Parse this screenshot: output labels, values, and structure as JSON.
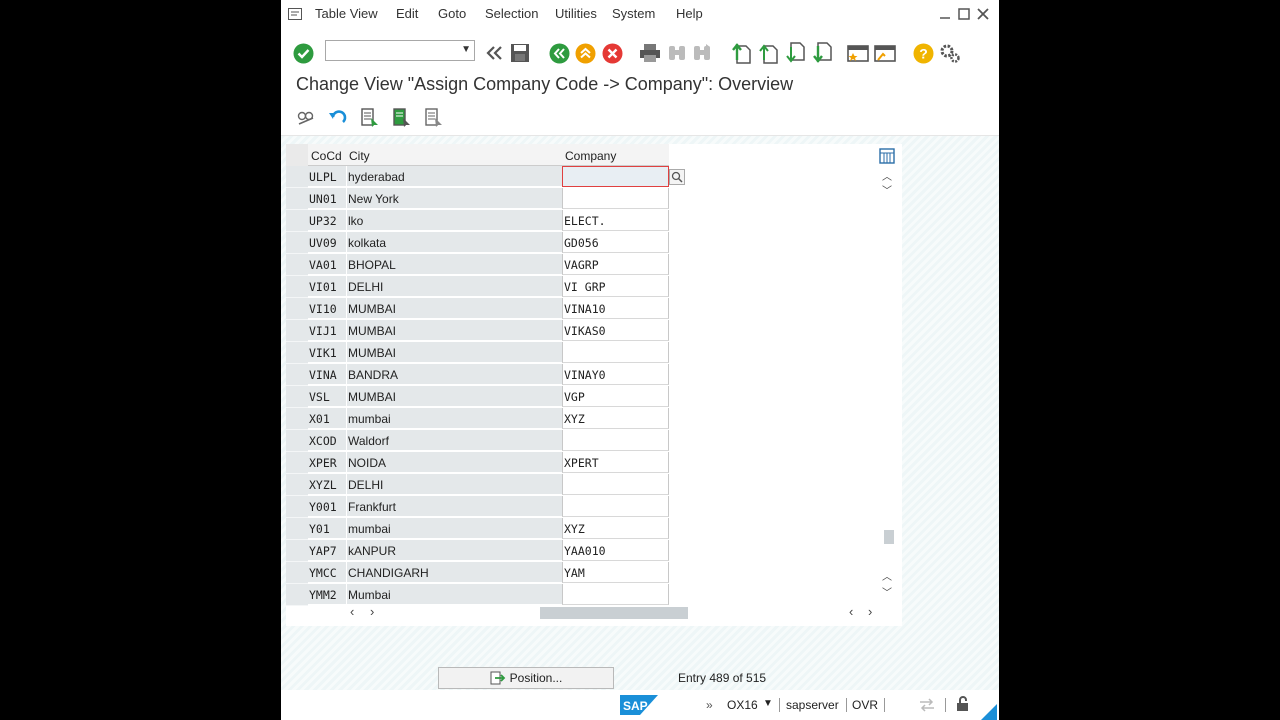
{
  "menu": [
    "Table View",
    "Edit",
    "Goto",
    "Selection",
    "Utilities",
    "System",
    "Help"
  ],
  "title": "Change View \"Assign Company Code -> Company\": Overview",
  "table": {
    "columns": [
      "CoCd",
      "City",
      "Company"
    ],
    "rows": [
      {
        "cocd": "ULPL",
        "city": "hyderabad",
        "company": ""
      },
      {
        "cocd": "UN01",
        "city": "New York",
        "company": ""
      },
      {
        "cocd": "UP32",
        "city": "lko",
        "company": "ELECT."
      },
      {
        "cocd": "UV09",
        "city": "kolkata",
        "company": "GD056"
      },
      {
        "cocd": "VA01",
        "city": "BHOPAL",
        "company": "VAGRP"
      },
      {
        "cocd": "VI01",
        "city": "DELHI",
        "company": "VI GRP"
      },
      {
        "cocd": "VI10",
        "city": "MUMBAI",
        "company": "VINA10"
      },
      {
        "cocd": "VIJ1",
        "city": "MUMBAI",
        "company": "VIKAS0"
      },
      {
        "cocd": "VIK1",
        "city": "MUMBAI",
        "company": ""
      },
      {
        "cocd": "VINA",
        "city": "BANDRA",
        "company": "VINAY0"
      },
      {
        "cocd": "VSL",
        "city": "MUMBAI",
        "company": "VGP"
      },
      {
        "cocd": "X01",
        "city": "mumbai",
        "company": "XYZ"
      },
      {
        "cocd": "XCOD",
        "city": "Waldorf",
        "company": ""
      },
      {
        "cocd": "XPER",
        "city": "NOIDA",
        "company": "XPERT"
      },
      {
        "cocd": "XYZL",
        "city": "DELHI",
        "company": ""
      },
      {
        "cocd": "Y001",
        "city": "Frankfurt",
        "company": ""
      },
      {
        "cocd": "Y01",
        "city": "mumbai",
        "company": "XYZ"
      },
      {
        "cocd": "YAP7",
        "city": "kANPUR",
        "company": "YAA010"
      },
      {
        "cocd": "YMCC",
        "city": "CHANDIGARH",
        "company": "YAM"
      },
      {
        "cocd": "YMM2",
        "city": "Mumbai",
        "company": ""
      }
    ]
  },
  "position_button": "Position...",
  "entry_text": "Entry 489 of 515",
  "status": {
    "tcode": "OX16",
    "server": "sapserver",
    "mode": "OVR",
    "logo": "SAP"
  },
  "colors": {
    "green": "#2e9b3f",
    "orange": "#f0a000",
    "red": "#e53935",
    "sap_blue": "#1a8fd8"
  }
}
